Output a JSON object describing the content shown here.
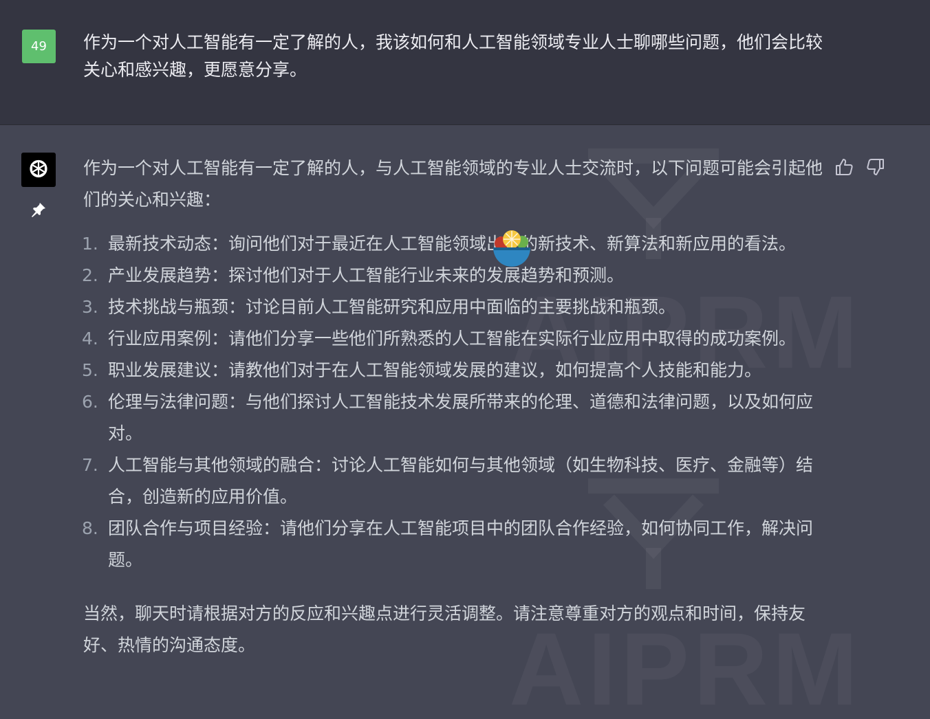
{
  "user_message": {
    "avatar_label": "49",
    "text": "作为一个对人工智能有一定了解的人，我该如何和人工智能领域专业人士聊哪些问题，他们会比较关心和感兴趣，更愿意分享。"
  },
  "assistant_message": {
    "intro": "作为一个对人工智能有一定了解的人，与人工智能领域的专业人士交流时，以下问题可能会引起他们的关心和兴趣：",
    "items": [
      {
        "num": "1.",
        "text": "最新技术动态：询问他们对于最近在人工智能领域出现的新技术、新算法和新应用的看法。"
      },
      {
        "num": "2.",
        "text": "产业发展趋势：探讨他们对于人工智能行业未来的发展趋势和预测。"
      },
      {
        "num": "3.",
        "text": "技术挑战与瓶颈：讨论目前人工智能研究和应用中面临的主要挑战和瓶颈。"
      },
      {
        "num": "4.",
        "text": "行业应用案例：请他们分享一些他们所熟悉的人工智能在实际行业应用中取得的成功案例。"
      },
      {
        "num": "5.",
        "text": "职业发展建议：请教他们对于在人工智能领域发展的建议，如何提高个人技能和能力。"
      },
      {
        "num": "6.",
        "text": "伦理与法律问题：与他们探讨人工智能技术发展所带来的伦理、道德和法律问题，以及如何应对。"
      },
      {
        "num": "7.",
        "text": "人工智能与其他领域的融合：讨论人工智能如何与其他领域（如生物科技、医疗、金融等）结合，创造新的应用价值。"
      },
      {
        "num": "8.",
        "text": "团队合作与项目经验：请他们分享在人工智能项目中的团队合作经验，如何协同工作，解决问题。"
      }
    ],
    "outro": "当然，聊天时请根据对方的反应和兴趣点进行灵活调整。请注意尊重对方的观点和时间，保持友好、热情的沟通态度。"
  },
  "watermark": {
    "text_top": "AIPRM",
    "text_bottom": "AIPRM"
  },
  "icons": {
    "assistant_avatar": "openai-logo-icon",
    "pin": "pin-icon",
    "thumb_up": "thumbs-up-icon",
    "thumb_down": "thumbs-down-icon",
    "overlay": "salad-bowl-icon"
  },
  "colors": {
    "user_avatar": "#5fbf6e",
    "user_bg": "#343541",
    "assistant_bg": "#444654"
  }
}
